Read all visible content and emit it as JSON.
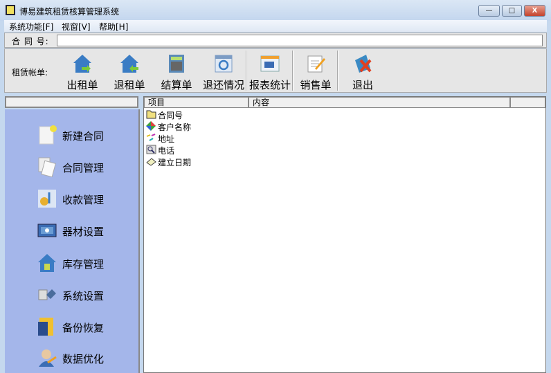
{
  "window": {
    "title": "博易建筑租赁核算管理系统",
    "minimize": "—",
    "restore": "□",
    "close": "X"
  },
  "menu": [
    "系统功能[F]",
    "视窗[V]",
    "帮助[H]"
  ],
  "contract": {
    "label": "合 同 号:",
    "value": ""
  },
  "toolbar": {
    "label": "租赁帐单:",
    "buttons": [
      {
        "label": "出租单",
        "icon": "house-out-icon"
      },
      {
        "label": "退租单",
        "icon": "house-return-icon"
      },
      {
        "label": "结算单",
        "icon": "calculator-icon"
      },
      {
        "label": "退还情况",
        "icon": "refresh-window-icon"
      },
      {
        "label": "报表统计",
        "icon": "report-icon"
      },
      {
        "label": "销售单",
        "icon": "notepad-icon"
      },
      {
        "label": "退出",
        "icon": "exit-icon"
      }
    ]
  },
  "sidebar": [
    "新建合同",
    "合同管理",
    "收款管理",
    "器材设置",
    "库存管理",
    "系统设置",
    "备份恢复",
    "数据优化"
  ],
  "table": {
    "columns": [
      "项目",
      "内容",
      ""
    ],
    "rows": [
      "合同号",
      "客户名称",
      "地址",
      "电话",
      "建立日期"
    ]
  }
}
